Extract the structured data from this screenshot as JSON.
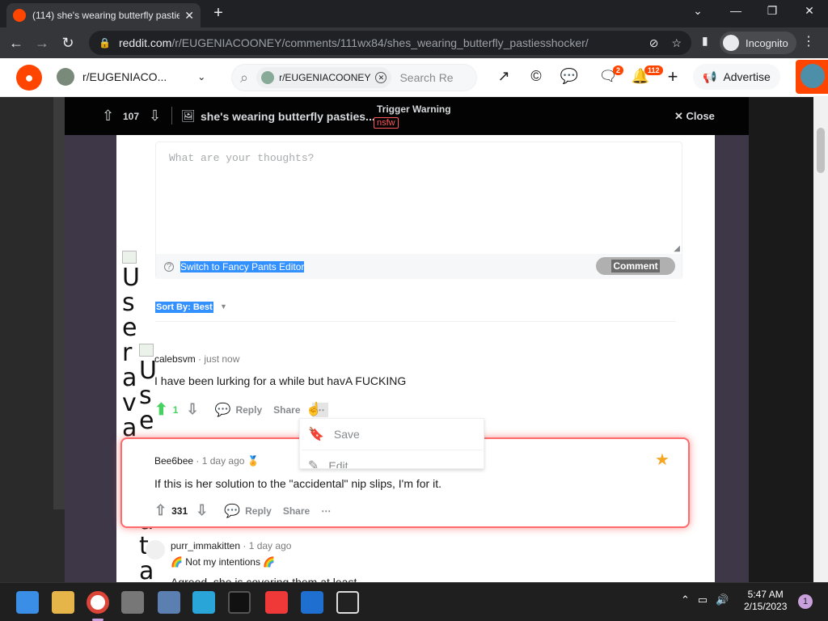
{
  "browser": {
    "tab_title": "(114) she's wearing butterfly pasties",
    "tab_close": "✕",
    "new_tab": "+",
    "url_domain": "reddit.com",
    "url_path": "/r/EUGENIACOONEY/comments/111wx84/shes_wearing_butterfly_pastiesshocker/",
    "incognito_label": "Incognito"
  },
  "reddit_header": {
    "subreddit": "r/EUGENIACO...",
    "search_chip": "r/EUGENIACOONEY",
    "search_placeholder": "Search Re",
    "chat_badge": "2",
    "notif_badge": "112",
    "advertise": "Advertise"
  },
  "post_bar": {
    "votes": "107",
    "title": "she's wearing butterfly pasties...",
    "trigger_warning": "Trigger Warning",
    "nsfw": "nsfw",
    "close": "Close"
  },
  "editor": {
    "placeholder": "What are your thoughts?",
    "fancy_pants": "Switch to Fancy Pants Editor",
    "comment_button": "Comment"
  },
  "sort": {
    "label": "Sort By: Best"
  },
  "broken_avatar_alt": "User avatar",
  "comments": [
    {
      "user": "calebsvm",
      "time": "· just now",
      "body": "I have been lurking for a while but havA FUCKING",
      "votes": "1",
      "reply": "Reply",
      "share": "Share"
    },
    {
      "user": "Bee6bee",
      "time": "· 1 day ago",
      "body": "If this is her solution to the \"accidental\" nip slips, I'm for it.",
      "votes": "331",
      "reply": "Reply",
      "share": "Share"
    },
    {
      "user": "purr_immakitten",
      "time": "· 1 day ago",
      "flair": "🌈 Not my intentions 🌈",
      "body": "Agreed, she is covering them at least"
    }
  ],
  "dropdown": {
    "save": "Save",
    "edit": "Edit"
  },
  "taskbar": {
    "time": "5:47 AM",
    "date": "2/15/2023",
    "notifications": "1"
  },
  "colors": {
    "reddit_orange": "#ff4500",
    "upvote_green": "#46d160",
    "highlight_red": "#ff6a6a",
    "selection_blue": "#3390ff"
  }
}
